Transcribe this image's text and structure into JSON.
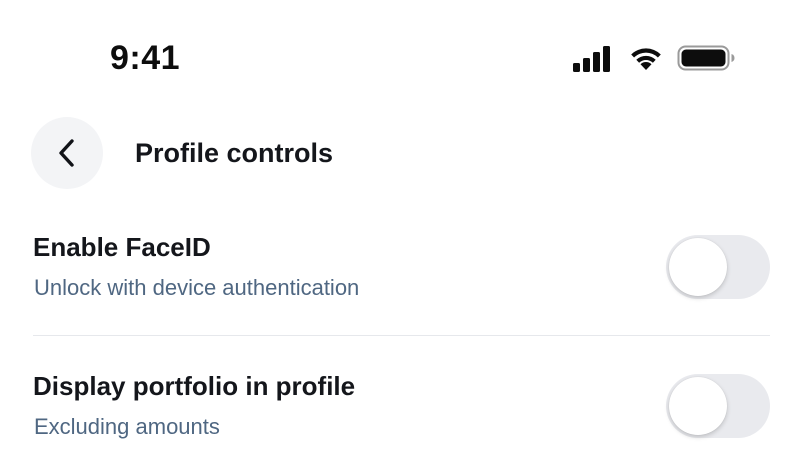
{
  "status_bar": {
    "time": "9:41",
    "icons": [
      "cellular-signal-icon",
      "wifi-icon",
      "battery-icon"
    ]
  },
  "nav": {
    "back_icon": "chevron-left-icon",
    "title": "Profile controls"
  },
  "settings": [
    {
      "title": "Enable FaceID",
      "subtitle": "Unlock with device authentication",
      "enabled": false
    },
    {
      "title": "Display portfolio in profile",
      "subtitle": "Excluding amounts",
      "enabled": false
    }
  ],
  "colors": {
    "subtitle": "#4f6782",
    "toggle_off_track": "#e9eaee",
    "back_button_bg": "#f3f4f6",
    "divider": "#e6e8ec"
  }
}
